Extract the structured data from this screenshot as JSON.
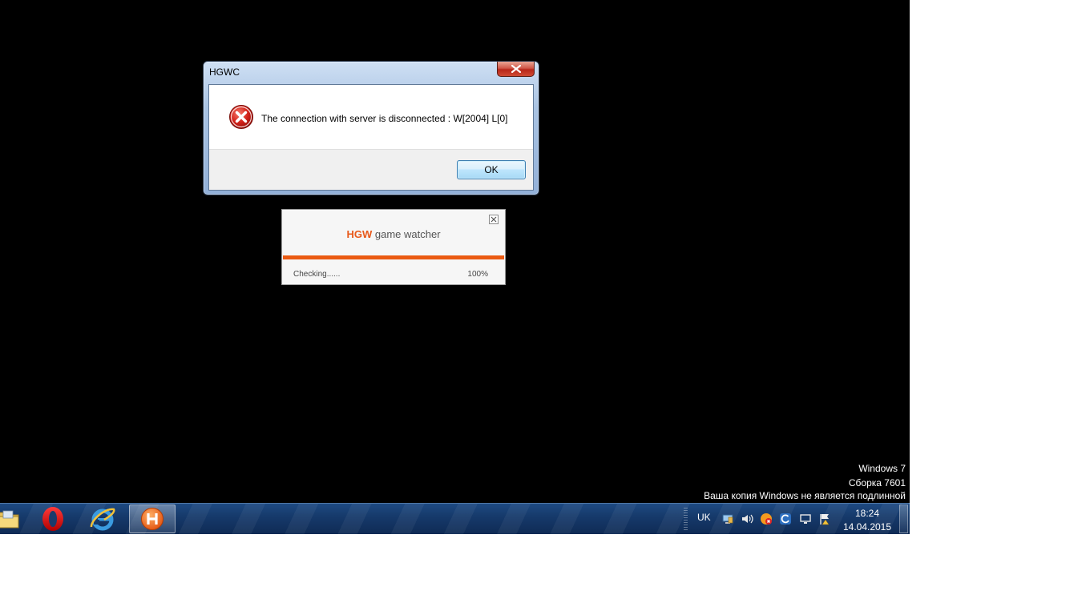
{
  "dialog": {
    "title": "HGWC",
    "message": "The connection with server is disconnected : W[2004] L[0]",
    "ok_label": "OK",
    "icon": "error-icon"
  },
  "watcher": {
    "brand_prefix": "HGW",
    "brand_suffix": "game watcher",
    "status": "Checking......",
    "percent_label": "100%",
    "progress": 1.0,
    "accent_color": "#ea5a12"
  },
  "watermark": {
    "line1": "Windows 7",
    "line2": "Сборка 7601",
    "line3": "Ваша копия Windows не является подлинной"
  },
  "taskbar": {
    "pinned": [
      "folder-icon",
      "opera-icon",
      "internet-explorer-icon",
      "hgw-app-icon"
    ],
    "tray": {
      "language": "UK",
      "icons": [
        "network-monitor-icon",
        "volume-icon",
        "security-alert-icon",
        "sync-icon",
        "display-icon",
        "action-center-flag-icon"
      ],
      "time": "18:24",
      "date": "14.04.2015"
    }
  }
}
